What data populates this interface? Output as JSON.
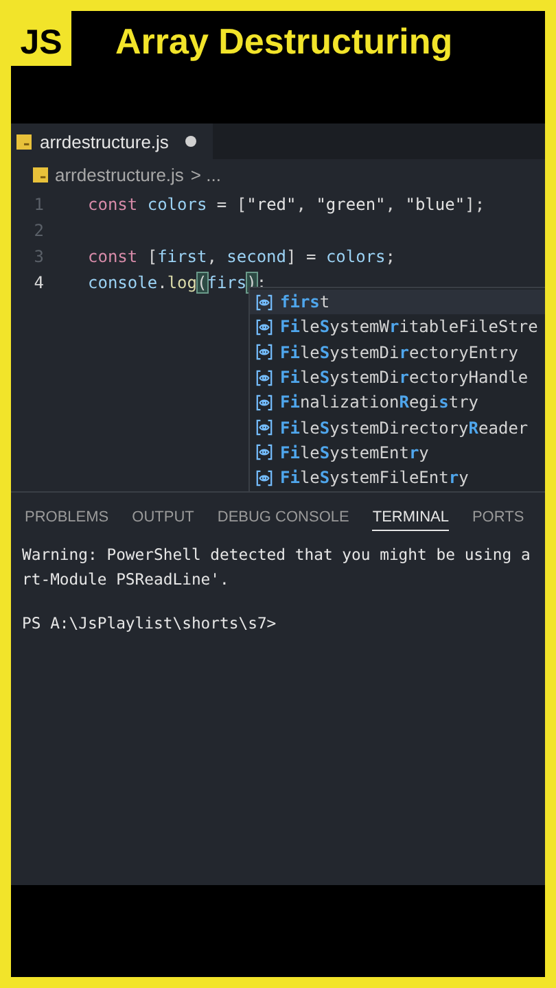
{
  "header": {
    "logo": "JS",
    "title": "Array Destructuring"
  },
  "editor": {
    "tabs": [
      {
        "label": "arrdestructure.js",
        "modified": true,
        "selected": true
      }
    ],
    "breadcrumb": {
      "file": "arrdestructure.js",
      "rest": "> ..."
    },
    "lines": [
      {
        "number": "1",
        "active": false,
        "tokens": [
          {
            "kind": "keyword",
            "text": "const"
          },
          {
            "kind": "variable",
            "text": " colors"
          },
          {
            "kind": "operator",
            "text": " = "
          },
          {
            "kind": "punct",
            "text": "["
          },
          {
            "kind": "string",
            "text": "\"red\""
          },
          {
            "kind": "punct",
            "text": ", "
          },
          {
            "kind": "string",
            "text": "\"green\""
          },
          {
            "kind": "punct",
            "text": ", "
          },
          {
            "kind": "string",
            "text": "\"blue\""
          },
          {
            "kind": "punct",
            "text": "];"
          }
        ]
      },
      {
        "number": "2",
        "active": false
      },
      {
        "number": "3",
        "active": false,
        "tokens": [
          {
            "kind": "keyword",
            "text": "const"
          },
          {
            "kind": "punct",
            "text": " ["
          },
          {
            "kind": "variable",
            "text": "first"
          },
          {
            "kind": "punct",
            "text": ", "
          },
          {
            "kind": "variable",
            "text": "second"
          },
          {
            "kind": "punct",
            "text": "]"
          },
          {
            "kind": "operator",
            "text": " = "
          },
          {
            "kind": "variable",
            "text": "colors"
          },
          {
            "kind": "punct",
            "text": ";"
          }
        ]
      },
      {
        "number": "4",
        "active": true,
        "tokens": [
          {
            "kind": "variable",
            "text": "console"
          },
          {
            "kind": "punct",
            "text": "."
          },
          {
            "kind": "function",
            "text": "log"
          },
          {
            "kind": "bracket",
            "text": "("
          },
          {
            "kind": "variable",
            "text": "firs"
          },
          {
            "kind": "bracket",
            "text": ")"
          },
          {
            "kind": "punct",
            "text": ";"
          }
        ]
      }
    ],
    "suggestions": [
      {
        "selected": true,
        "parts": [
          {
            "text": "firs",
            "match": true
          },
          {
            "text": "t",
            "match": false
          }
        ]
      },
      {
        "selected": false,
        "parts": [
          {
            "text": "Fi",
            "match": true
          },
          {
            "text": "le",
            "match": false
          },
          {
            "text": "S",
            "match": true
          },
          {
            "text": "ystemW",
            "match": false
          },
          {
            "text": "r",
            "match": true
          },
          {
            "text": "itableFileStre",
            "match": false
          }
        ]
      },
      {
        "selected": false,
        "parts": [
          {
            "text": "Fi",
            "match": true
          },
          {
            "text": "le",
            "match": false
          },
          {
            "text": "S",
            "match": true
          },
          {
            "text": "ystemDi",
            "match": false
          },
          {
            "text": "r",
            "match": true
          },
          {
            "text": "ectoryEntry",
            "match": false
          }
        ]
      },
      {
        "selected": false,
        "parts": [
          {
            "text": "Fi",
            "match": true
          },
          {
            "text": "le",
            "match": false
          },
          {
            "text": "S",
            "match": true
          },
          {
            "text": "ystemDi",
            "match": false
          },
          {
            "text": "r",
            "match": true
          },
          {
            "text": "ectoryHandle",
            "match": false
          }
        ]
      },
      {
        "selected": false,
        "parts": [
          {
            "text": "Fi",
            "match": true
          },
          {
            "text": "nalization",
            "match": false
          },
          {
            "text": "R",
            "match": true
          },
          {
            "text": "egi",
            "match": false
          },
          {
            "text": "s",
            "match": true
          },
          {
            "text": "try",
            "match": false
          }
        ]
      },
      {
        "selected": false,
        "parts": [
          {
            "text": "Fi",
            "match": true
          },
          {
            "text": "le",
            "match": false
          },
          {
            "text": "S",
            "match": true
          },
          {
            "text": "ystemDirectory",
            "match": false
          },
          {
            "text": "R",
            "match": true
          },
          {
            "text": "eader",
            "match": false
          }
        ]
      },
      {
        "selected": false,
        "parts": [
          {
            "text": "Fi",
            "match": true
          },
          {
            "text": "le",
            "match": false
          },
          {
            "text": "S",
            "match": true
          },
          {
            "text": "ystemEnt",
            "match": false
          },
          {
            "text": "r",
            "match": true
          },
          {
            "text": "y",
            "match": false
          }
        ]
      },
      {
        "selected": false,
        "parts": [
          {
            "text": "Fi",
            "match": true
          },
          {
            "text": "le",
            "match": false
          },
          {
            "text": "S",
            "match": true
          },
          {
            "text": "ystemFileEnt",
            "match": false
          },
          {
            "text": "r",
            "match": true
          },
          {
            "text": "y",
            "match": false
          }
        ]
      }
    ]
  },
  "panel": {
    "tabs": [
      {
        "label": "PROBLEMS",
        "selected": false
      },
      {
        "label": "OUTPUT",
        "selected": false
      },
      {
        "label": "DEBUG CONSOLE",
        "selected": false
      },
      {
        "label": "TERMINAL",
        "selected": true
      },
      {
        "label": "PORTS",
        "selected": false
      }
    ],
    "terminal_lines": [
      {
        "kind": "output",
        "text": "Warning: PowerShell detected that you might be using a"
      },
      {
        "kind": "output",
        "text": "rt-Module PSReadLine'."
      },
      {
        "kind": "prompt",
        "text": "PS A:\\JsPlaylist\\shorts\\s7>"
      }
    ]
  }
}
